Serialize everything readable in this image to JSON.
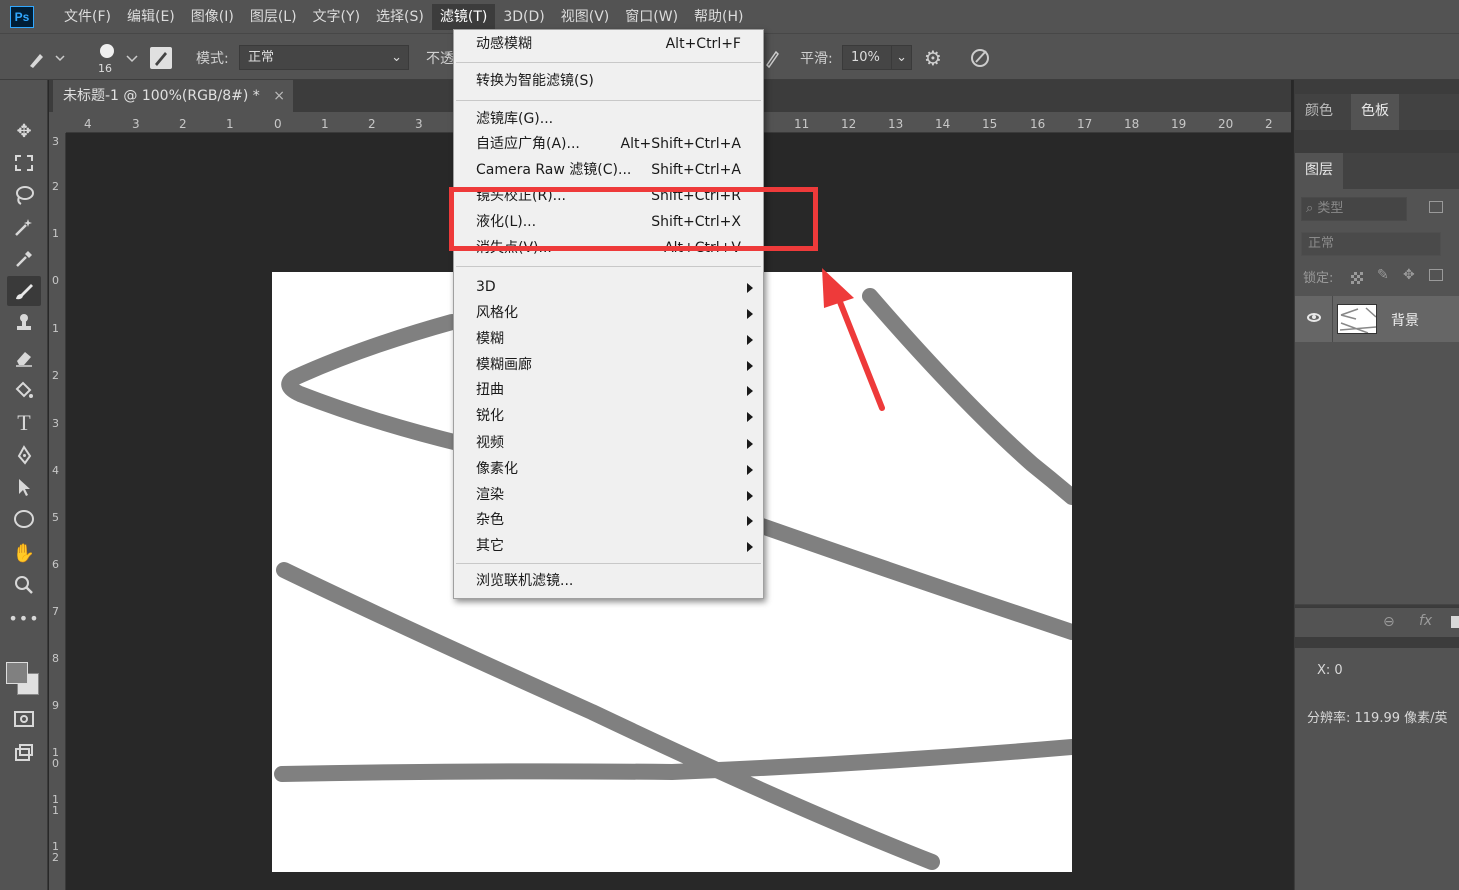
{
  "menubar": {
    "logo": "Ps",
    "items": [
      "文件(F)",
      "编辑(E)",
      "图像(I)",
      "图层(L)",
      "文字(Y)",
      "选择(S)",
      "滤镜(T)",
      "3D(D)",
      "视图(V)",
      "窗口(W)",
      "帮助(H)"
    ],
    "active_index": 6
  },
  "options": {
    "brush_size": "16",
    "mode_label": "模式:",
    "mode_value": "正常",
    "opacity_label": "不透",
    "smooth_label": "平滑:",
    "smooth_value": "10%"
  },
  "document": {
    "tab_title": "未标题-1 @ 100%(RGB/8#) *",
    "close": "×"
  },
  "ruler": {
    "h_labels": [
      "4",
      "3",
      "2",
      "1",
      "0",
      "1",
      "2",
      "3",
      "11",
      "12",
      "13",
      "14",
      "15",
      "16",
      "17",
      "18",
      "19",
      "20",
      "2"
    ],
    "v_labels": [
      "3",
      "2",
      "1",
      "0",
      "1",
      "2",
      "3",
      "4",
      "5",
      "6",
      "7",
      "8",
      "9",
      "10",
      "11",
      "12"
    ]
  },
  "filter_menu": {
    "items": [
      {
        "label": "动感模糊",
        "shortcut": "Alt+Ctrl+F"
      },
      {
        "label": "转换为智能滤镜(S)",
        "shortcut": ""
      },
      {
        "label": "滤镜库(G)...",
        "shortcut": ""
      },
      {
        "label": "自适应广角(A)...",
        "shortcut": "Alt+Shift+Ctrl+A"
      },
      {
        "label": "Camera Raw 滤镜(C)...",
        "shortcut": "Shift+Ctrl+A"
      },
      {
        "label": "镜头校正(R)...",
        "shortcut": "Shift+Ctrl+R"
      },
      {
        "label": "液化(L)...",
        "shortcut": "Shift+Ctrl+X"
      },
      {
        "label": "消失点(V)...",
        "shortcut": "Alt+Ctrl+V"
      },
      {
        "label": "3D",
        "shortcut": ""
      },
      {
        "label": "风格化",
        "shortcut": ""
      },
      {
        "label": "模糊",
        "shortcut": ""
      },
      {
        "label": "模糊画廊",
        "shortcut": ""
      },
      {
        "label": "扭曲",
        "shortcut": ""
      },
      {
        "label": "锐化",
        "shortcut": ""
      },
      {
        "label": "视频",
        "shortcut": ""
      },
      {
        "label": "像素化",
        "shortcut": ""
      },
      {
        "label": "渲染",
        "shortcut": ""
      },
      {
        "label": "杂色",
        "shortcut": ""
      },
      {
        "label": "其它",
        "shortcut": ""
      },
      {
        "label": "浏览联机滤镜...",
        "shortcut": ""
      }
    ]
  },
  "panels": {
    "color_tab": "颜色",
    "swatches_tab": "色板",
    "layers_tab": "图层",
    "kind_placeholder": "类型",
    "blend_mode": "正常",
    "lock_label": "锁定:",
    "layer_name": "背景",
    "fx": "fx",
    "info_x": "X: 0",
    "resolution": "分辨率: 119.99 像素/英"
  },
  "colors": {
    "highlight_box": "#ee3a3a",
    "stroke": "#808080"
  }
}
